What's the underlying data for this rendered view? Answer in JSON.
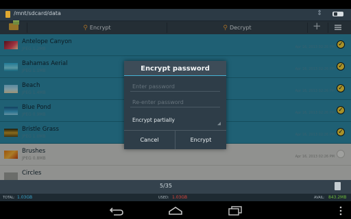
{
  "path": {
    "text": "/mnt/sdcard/data"
  },
  "toolbar": {
    "encrypt_label": "Encrypt",
    "decrypt_label": "Decrypt"
  },
  "files": [
    {
      "name": "Antelope Canyon",
      "meta": "JPEG 1.2MB",
      "date": "Apr 16, 2013 02:26 PM",
      "checked": true
    },
    {
      "name": "Bahamas Aerial",
      "meta": "JPEG 1.1MB",
      "date": "Apr 16, 2013 02:26 PM",
      "checked": true
    },
    {
      "name": "Beach",
      "meta": "JPEG 1.4MB",
      "date": "Apr 16, 2013 02:26 PM",
      "checked": true
    },
    {
      "name": "Blue Pond",
      "meta": "JPEG 0.9MB",
      "date": "Apr 16, 2013 02:26 PM",
      "checked": true
    },
    {
      "name": "Bristle Grass",
      "meta": "JPEG 1.0MB",
      "date": "Apr 16, 2013 02:26 PM",
      "checked": true
    },
    {
      "name": "Brushes",
      "meta": "JPEG 0.8MB",
      "date": "Apr 16, 2013 02:26 PM",
      "checked": false
    },
    {
      "name": "Circles",
      "meta": "",
      "date": "",
      "checked": false
    }
  ],
  "dialog": {
    "title": "Encrypt password",
    "password_placeholder": "Enter password",
    "confirm_placeholder": "Re-enter password",
    "mode_value": "Encrypt partially",
    "cancel_label": "Cancel",
    "confirm_label": "Encrypt"
  },
  "pager": {
    "text": "5/35"
  },
  "storage": {
    "total_label": "TOTAL:",
    "total_value": "1.03GB",
    "used_label": "USED:",
    "used_value": "1.03GB",
    "avail_label": "AVAIL:",
    "avail_value": "843.2MB"
  },
  "colors": {
    "selected_row": "#2d8aa6",
    "accent": "#46b4d6",
    "check": "#f2d23c"
  },
  "icons": [
    "sdcard-icon",
    "sort-icon",
    "view-icon",
    "folder-icon",
    "key-icon",
    "plus-icon",
    "menu-icon",
    "check-icon",
    "document-icon",
    "back-icon",
    "home-icon",
    "recents-icon",
    "overflow-icon"
  ]
}
